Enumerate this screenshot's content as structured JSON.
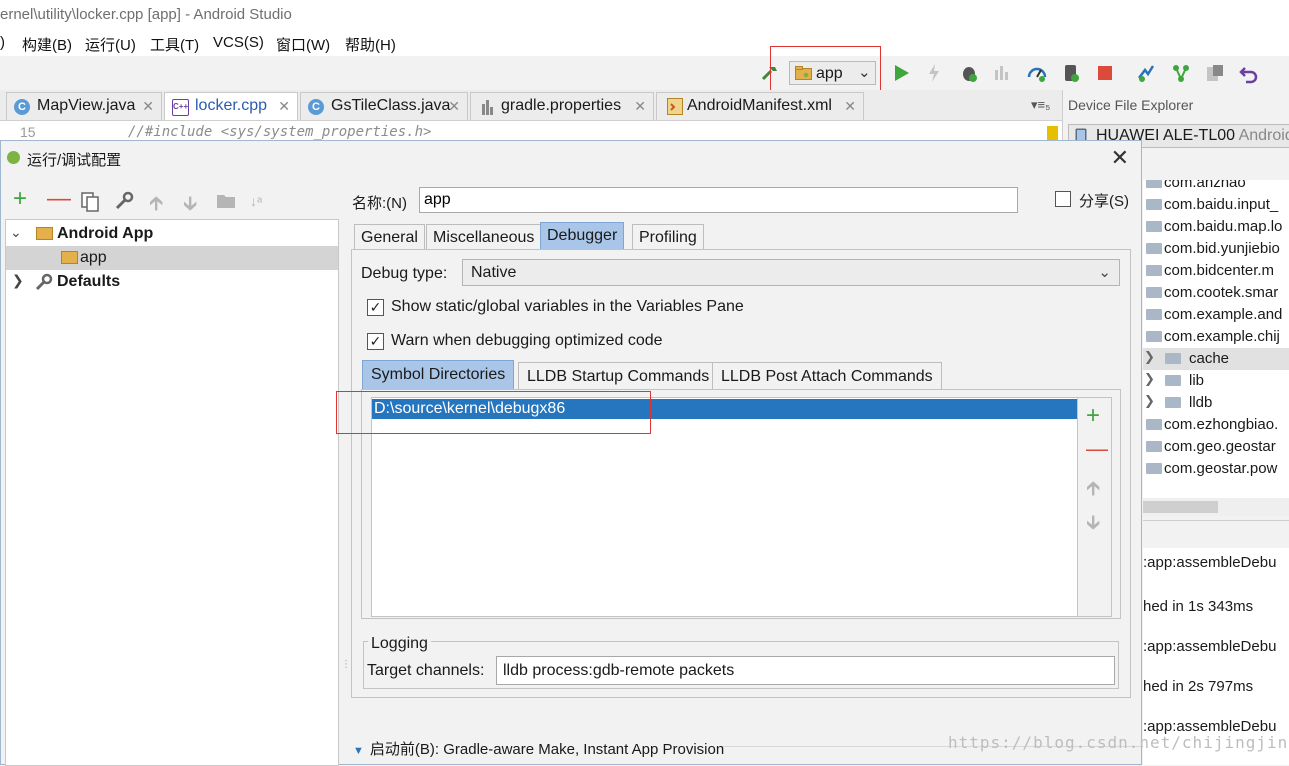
{
  "window": {
    "title": "ernel\\utility\\locker.cpp [app] - Android Studio"
  },
  "menu": [
    {
      "label": ")"
    },
    {
      "label": "构建(B)"
    },
    {
      "label": "运行(U)"
    },
    {
      "label": "工具(T)"
    },
    {
      "label": "VCS(S)"
    },
    {
      "label": "窗口(W)"
    },
    {
      "label": "帮助(H)"
    }
  ],
  "toolbar": {
    "run_config": "app",
    "icons": [
      "build-hammer-icon",
      "run-icon",
      "apply-changes-icon",
      "debug-icon",
      "profile-icon",
      "attach-debugger-icon",
      "apply-code-changes-icon",
      "stop-icon",
      "sync-gradle-icon",
      "avd-manager-icon",
      "sdk-manager-icon",
      "undo-icon"
    ]
  },
  "editor": {
    "tabs": [
      {
        "label": "MapView.java",
        "icon": "C",
        "active": false
      },
      {
        "label": "locker.cpp",
        "icon": "C++",
        "active": true
      },
      {
        "label": "GsTileClass.java",
        "icon": "C",
        "active": false
      },
      {
        "label": "gradle.properties",
        "icon": "gradle",
        "active": false
      },
      {
        "label": "AndroidManifest.xml",
        "icon": "manifest",
        "active": false
      }
    ],
    "overflow": "▾≡₅",
    "line_number": "15",
    "code": "//#include <sys/system_properties.h>"
  },
  "device_explorer": {
    "title": "Device File Explorer",
    "device": "HUAWEI ALE-TL00",
    "device_suffix": "Android",
    "items": [
      {
        "label": "com.anzhao",
        "level": 0
      },
      {
        "label": "com.baidu.input_",
        "level": 0
      },
      {
        "label": "com.baidu.map.lo",
        "level": 0
      },
      {
        "label": "com.bid.yunjiebio",
        "level": 0
      },
      {
        "label": "com.bidcenter.m",
        "level": 0
      },
      {
        "label": "com.cootek.smar",
        "level": 0
      },
      {
        "label": "com.example.and",
        "level": 0
      },
      {
        "label": "com.example.chij",
        "level": 0
      },
      {
        "label": "cache",
        "level": 1
      },
      {
        "label": "lib",
        "level": 1
      },
      {
        "label": "lldb",
        "level": 1
      },
      {
        "label": "com.ezhongbiao.",
        "level": 0
      },
      {
        "label": "com.geo.geostar",
        "level": 0
      },
      {
        "label": "com.geostar.pow",
        "level": 0
      }
    ],
    "console": [
      ":app:assembleDebu",
      "hed in 1s 343ms",
      ":app:assembleDebu",
      "hed in 2s 797ms",
      ":app:assembleDebu"
    ]
  },
  "dialog": {
    "title": "运行/调试配置",
    "close": "✕",
    "tree": [
      {
        "label": "Android App",
        "bold": true,
        "expanded": true
      },
      {
        "label": "app",
        "bold": false,
        "selected": true
      },
      {
        "label": "Defaults",
        "bold": true,
        "expanded": false
      }
    ],
    "name_label": "名称:(N)",
    "name_value": "app",
    "share_label": "分享(S)",
    "share_checked": false,
    "tabs": [
      "General",
      "Miscellaneous",
      "Debugger",
      "Profiling"
    ],
    "active_tab": "Debugger",
    "debug_type_label": "Debug type:",
    "debug_type_value": "Native",
    "checkboxes": [
      {
        "label": "Show static/global variables in the Variables Pane",
        "checked": true
      },
      {
        "label": "Warn when debugging optimized code",
        "checked": true
      }
    ],
    "subtabs": [
      "Symbol Directories",
      "LLDB Startup Commands",
      "LLDB Post Attach Commands"
    ],
    "active_subtab": "Symbol Directories",
    "symbol_directories": [
      "D:\\source\\kernel\\debugx86"
    ],
    "logging_title": "Logging",
    "target_channels_label": "Target channels:",
    "target_channels_value": "lldb process:gdb-remote packets",
    "before_launch": "启动前(B): Gradle-aware Make, Instant App Provision"
  },
  "watermark": "https://blog.csdn.net/chijingjing",
  "colors": {
    "selection": "#2675bf",
    "tab_active": "#a9c6e8",
    "highlight_box": "#e03434",
    "run_green": "#3fa63f",
    "stop_red": "#db4a3b"
  }
}
